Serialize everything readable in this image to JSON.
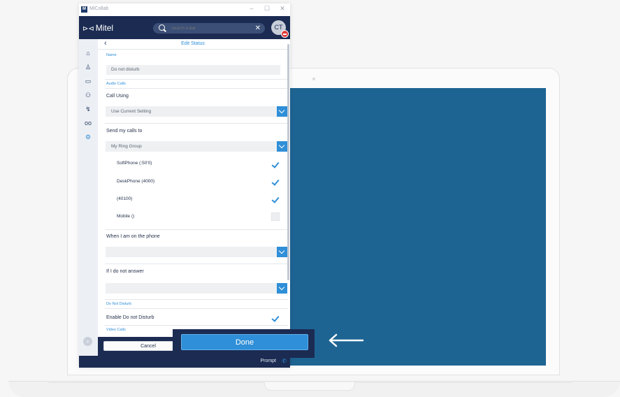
{
  "titlebar": {
    "app_name": "MiCollab",
    "logo": "M",
    "min": "–",
    "max": "☐",
    "close": "✕"
  },
  "header": {
    "brand": "Mitel",
    "brand_mark": "⊳⊲",
    "search_placeholder": "Search a Bar",
    "search_clear": "✕",
    "avatar_initials": "CT"
  },
  "sidebar": {
    "icons": [
      "home-icon",
      "person-icon",
      "chat-icon",
      "contacts-icon",
      "call-history-icon",
      "voicemail-icon",
      "settings-icon"
    ],
    "expand": "›"
  },
  "panel": {
    "back": "‹",
    "title": "Edit Status",
    "name_label": "Name",
    "name_value": "Do not disturb",
    "audio_calls": "Audio Calls",
    "call_using_label": "Call Using",
    "call_using_value": "Use Current Setting",
    "send_calls_label": "Send my calls to",
    "send_calls_value": "My Ring Group",
    "ring_options": [
      {
        "label": "SoftPhone (:50'0)",
        "checked": true
      },
      {
        "label": "DeskPhone (4000)",
        "checked": true
      },
      {
        "label": "(40100)",
        "checked": true
      },
      {
        "label": "Mobile ()",
        "checked": false
      }
    ],
    "on_phone_label": "When I am on the phone",
    "on_phone_value": "",
    "no_answer_label": "If I do not answer",
    "no_answer_value": "",
    "dnd_section": "Do Not Disturb",
    "enable_dnd_label": "Enable Do not Disturb",
    "enable_dnd_checked": true,
    "video_calls": "Video Calls"
  },
  "footer": {
    "cancel": "Cancel",
    "done": "Done"
  },
  "statusbar": {
    "prompt": "Prompt",
    "phone_icon": "✆"
  },
  "colors": {
    "navy": "#1b2b52",
    "accent": "#2f8fd8",
    "screen": "#1e6493"
  }
}
